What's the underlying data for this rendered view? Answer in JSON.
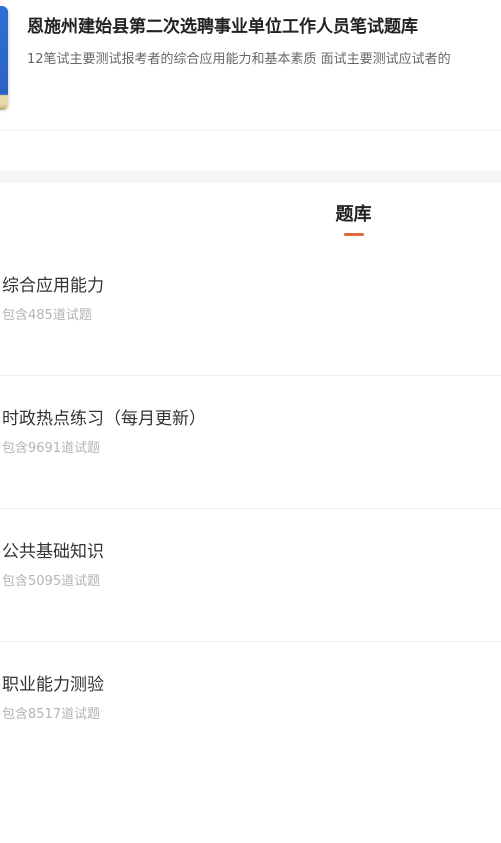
{
  "header": {
    "title": "恩施州建始县第二次选聘事业单位工作人员笔试题库",
    "description": "12笔试主要测试报考者的综合应用能力和基本素质 面试主要测试应试者的",
    "icon": "book-icon"
  },
  "tabs": [
    {
      "label": "题库",
      "active": true
    }
  ],
  "accent_color": "#e2683c",
  "question_banks": [
    {
      "name": "综合应用能力",
      "count": "包含485道试题"
    },
    {
      "name": "时政热点练习（每月更新）",
      "count": "包含9691道试题"
    },
    {
      "name": "公共基础知识",
      "count": "包含5095道试题"
    },
    {
      "name": "职业能力测验",
      "count": "包含8517道试题"
    }
  ]
}
